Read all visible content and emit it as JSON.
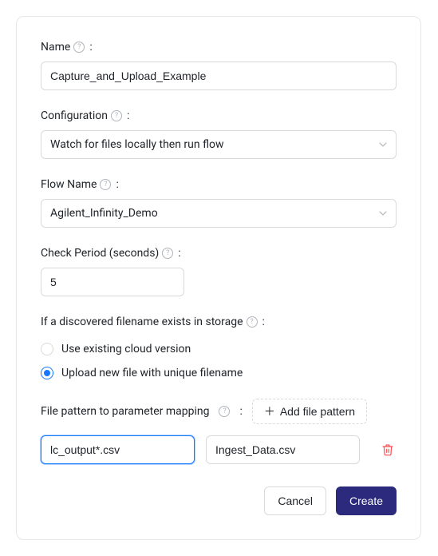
{
  "name": {
    "label": "Name",
    "value": "Capture_and_Upload_Example"
  },
  "configuration": {
    "label": "Configuration",
    "value": "Watch for files locally then run flow"
  },
  "flowName": {
    "label": "Flow Name",
    "value": "Agilent_Infinity_Demo"
  },
  "checkPeriod": {
    "label": "Check Period (seconds)",
    "value": "5"
  },
  "storagePolicy": {
    "label": "If a discovered filename exists in storage",
    "options": {
      "useExisting": "Use existing cloud version",
      "uploadNew": "Upload new file with unique filename"
    },
    "selected": "uploadNew"
  },
  "patternMapping": {
    "label": "File pattern to parameter mapping",
    "addButtonLabel": "Add file pattern",
    "rows": [
      {
        "pattern": "lc_output*.csv",
        "param": "Ingest_Data.csv"
      }
    ]
  },
  "footer": {
    "cancel": "Cancel",
    "create": "Create"
  }
}
